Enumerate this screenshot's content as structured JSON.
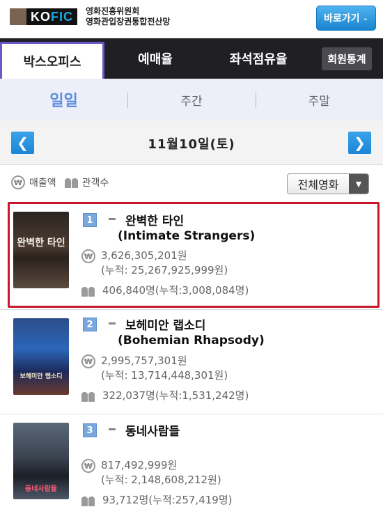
{
  "header": {
    "logo_text_dark": "KO",
    "logo_text_blue": "FIC",
    "org_line1": "영화진흥위원회",
    "org_line2": "영화관입장권통합전산망",
    "goto_label": "바로가기"
  },
  "tabs": [
    "박스오피스",
    "예매율",
    "좌석점유율",
    "회원통계"
  ],
  "subtabs": [
    "일일",
    "주간",
    "주말"
  ],
  "date": "11월10일(토)",
  "legend": {
    "sales_label": "매출액",
    "audience_label": "관객수"
  },
  "filter": {
    "selected": "전체영화"
  },
  "movies": [
    {
      "rank": "1",
      "title_ko": "완벽한 타인",
      "title_en": "(Intimate Strangers)",
      "sales": "3,626,305,201원",
      "sales_cumulative": "(누적: 25,267,925,999원)",
      "audience": "406,840명(누적:3,008,084명)",
      "poster_text": "완벽한 타인"
    },
    {
      "rank": "2",
      "title_ko": "보헤미안 랩소디",
      "title_en": "(Bohemian Rhapsody)",
      "sales": "2,995,757,301원",
      "sales_cumulative": "(누적: 13,714,448,301원)",
      "audience": "322,037명(누적:1,531,242명)",
      "poster_text": "보헤미안 랩소디"
    },
    {
      "rank": "3",
      "title_ko": "동네사람들",
      "title_en": "",
      "sales": "817,492,999원",
      "sales_cumulative": "(누적: 2,148,608,212원)",
      "audience": "93,712명(누적:257,419명)",
      "poster_text": "동네사람들"
    }
  ],
  "colors": {
    "tab_bar": "#1f1f24",
    "active_tab_border": "#6a58c8",
    "subtab_bg": "#eceef8",
    "active_subtab": "#5b8ce0",
    "arrow_button": "#1c86d6",
    "highlight_border": "#c8172a",
    "rank_badge": "#7aa8dd"
  },
  "icons": {
    "won": "won-coin-icon",
    "people": "people-icon",
    "prev": "chevron-left-icon",
    "next": "chevron-right-icon",
    "dropdown": "triangle-down-icon"
  }
}
